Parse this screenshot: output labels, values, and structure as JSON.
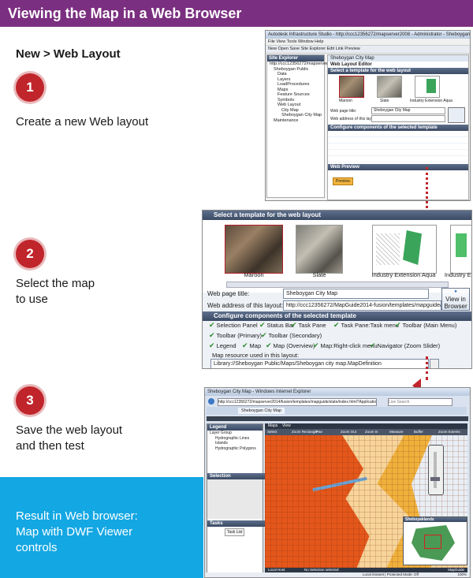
{
  "banner": {
    "title": "Viewing the Map in a Web Browser"
  },
  "heading": "New > Web Layout",
  "steps": [
    {
      "number": "1",
      "text": "Create a new Web layout"
    },
    {
      "number": "2",
      "text_line1": "Select the map",
      "text_line2": "to use"
    },
    {
      "number": "3",
      "text_line1": "Save the web layout",
      "text_line2": "and then test"
    }
  ],
  "result": {
    "line1": "Result in Web browser:",
    "line2": "Map with DWF Viewer",
    "line3": "controls"
  },
  "colors": {
    "banner": "#7b2f80",
    "step_circle": "#c0252b",
    "result_box": "#13a7e3"
  },
  "screenshot1": {
    "title": "Autodesk Infrastructure Studio - http://ccc12356272/mapserver2008 - Administrator - Sheboygan City Map",
    "menu": "File   View   Tools   Window   Help",
    "toolbar": "New   Open   Save   Site Explorer   Edit   Link   Preview",
    "explorer_title": "Site Explorer",
    "explorer_items": [
      "http://ccc12356272/mapserver2008",
      "Sheboygan Public",
      "Data",
      "Layers",
      "LoadProcedures",
      "Maps",
      "Feature Sources",
      "Symbols",
      "Web Layout",
      "City Map",
      "Sheboygan City Map",
      "Maintenance"
    ],
    "editor_tab": "Sheboygan City Map",
    "editor_title": "Web Layout Editor",
    "section1": "Select a template for the web layout",
    "templates": [
      "Maroon",
      "Slate",
      "Industry Extension Aqua"
    ],
    "web_page_title_label": "Web page title:",
    "web_page_title_value": "Sheboygan City Map",
    "web_address_label": "Web address of this layout:",
    "section2": "Configure components of the selected template",
    "web_preview": "Web Preview",
    "view_button": "Preview"
  },
  "screenshot2": {
    "panel_title": "Select a template for the web layout",
    "templates": [
      "Maroon",
      "Slate",
      "Industry Extension Aqua",
      "Industry Exter"
    ],
    "web_page_title_label": "Web page title:",
    "web_page_title_value": "Sheboygan City Map",
    "web_address_label": "Web address of this layout:",
    "web_address_value": "http://ccc12356272/MapGuide2014-fusion/templates/mapguide/slate/inc",
    "view_button_line1": "View in",
    "view_button_line2": "Browser",
    "components_title": "Configure components of the selected template",
    "components_row1": [
      "Selection Panel",
      "Status Bar",
      "Task Pane",
      "Task Pane:Task menu",
      "Toolbar (Main Menu)"
    ],
    "components_row2": [
      "Toolbar (Primary)",
      "Toolbar (Secondary)"
    ],
    "components_row3": [
      "Legend",
      "Map",
      "Map (Overview)",
      "Map:Right-click menu",
      "Navigator (Zoom Slider)"
    ],
    "map_resource_label": "Map resource used in this layout:",
    "map_resource_value": "Library://Sheboygan Public/Maps/Sheboygan city map.MapDefinition"
  },
  "screenshot3": {
    "title": "Sheboygan City Map - Windows Internet Explorer",
    "address": "http://ccc12356272/mapserver2014/fusion/templates/mapguide/slate/index.html?ApplicationD...",
    "search": "Live Search",
    "tab": "Sheboygan City Map",
    "legend_title": "Legend",
    "legend_items": [
      "Layer Group",
      "Hydrographic Lines",
      "Islands",
      "Hydrographic Polygons"
    ],
    "selection_title": "Selection",
    "tasks_title": "Tasks",
    "task_menu": "Task List",
    "map_tabs": [
      "Maps",
      "View"
    ],
    "map_toolbar": [
      "Select",
      "Zoom Rectangle",
      "Pan",
      "Zoom Out",
      "Zoom In",
      "Measure",
      "Buffer",
      "Zoom Extents"
    ],
    "overview_label": "Sheboyaklands",
    "status_left": "Local Host",
    "status_mid": "No Selection selected",
    "status_right": "Local intranet | Protected Mode: Off",
    "zoom": "100%",
    "scale": "MapGuide"
  }
}
